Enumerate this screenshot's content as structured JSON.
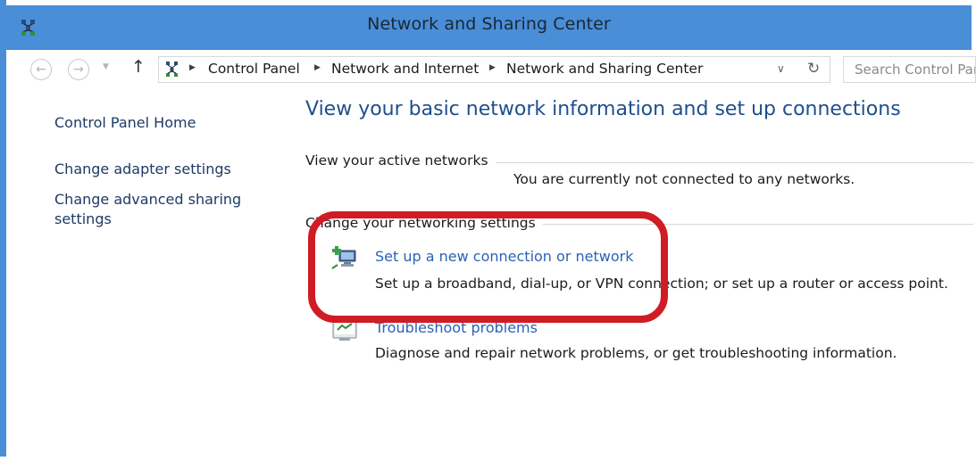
{
  "window": {
    "title": "Network and Sharing Center",
    "accent_color": "#4a8ed8",
    "highlight_color": "#d01c25"
  },
  "navigation": {
    "back_icon": "arrow-left-icon",
    "forward_icon": "arrow-right-icon",
    "up_icon": "arrow-up-icon",
    "recent_icon": "chevron-down-icon",
    "breadcrumbs": [
      "Control Panel",
      "Network and Internet",
      "Network and Sharing Center"
    ],
    "refresh_icon": "refresh-icon",
    "search_placeholder": "Search Control Panel"
  },
  "sidebar": {
    "items": [
      "Control Panel Home",
      "Change adapter settings",
      "Change advanced sharing settings"
    ]
  },
  "main": {
    "heading": "View your basic network information and set up connections",
    "active_networks": {
      "label": "View your active networks",
      "status": "You are currently not connected to any networks."
    },
    "settings": {
      "label": "Change your networking settings",
      "tasks": [
        {
          "icon": "network-setup-icon",
          "title": "Set up a new connection or network",
          "description": "Set up a broadband, dial-up, or VPN connection; or set up a router or access point."
        },
        {
          "icon": "troubleshoot-icon",
          "title": "Troubleshoot problems",
          "description": "Diagnose and repair network problems, or get troubleshooting information."
        }
      ]
    }
  }
}
